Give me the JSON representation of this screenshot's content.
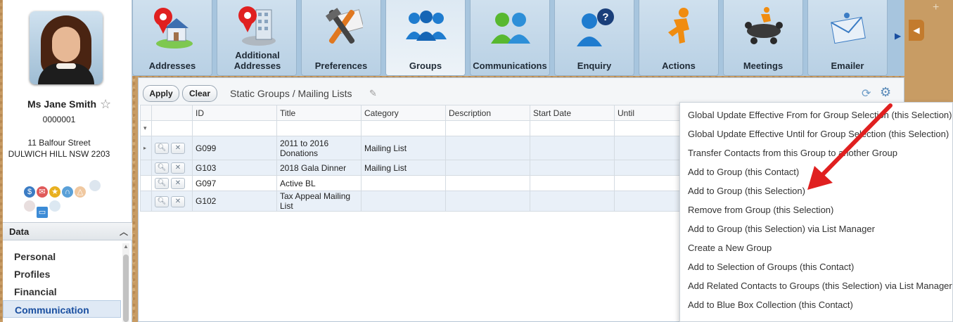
{
  "contact": {
    "name": "Ms Jane Smith",
    "id": "0000001",
    "address_line1": "11 Balfour Street",
    "address_line2": "DULWICH HILL NSW 2203"
  },
  "sidebar": {
    "section_title": "Data",
    "items": [
      {
        "label": "Personal"
      },
      {
        "label": "Profiles"
      },
      {
        "label": "Financial"
      },
      {
        "label": "Communication"
      }
    ],
    "active_item": "Communication"
  },
  "tabs": [
    {
      "label": "Addresses",
      "icon": "map-pin-house-icon"
    },
    {
      "label": "Additional Addresses",
      "icon": "map-pin-building-icon"
    },
    {
      "label": "Preferences",
      "icon": "tools-icon"
    },
    {
      "label": "Groups",
      "icon": "people-group-icon"
    },
    {
      "label": "Communications",
      "icon": "people-talking-icon"
    },
    {
      "label": "Enquiry",
      "icon": "person-question-icon"
    },
    {
      "label": "Actions",
      "icon": "running-person-icon"
    },
    {
      "label": "Meetings",
      "icon": "meeting-table-icon"
    },
    {
      "label": "Emailer",
      "icon": "envelope-icon"
    }
  ],
  "active_tab": "Groups",
  "toolbar": {
    "apply_label": "Apply",
    "clear_label": "Clear",
    "title": "Static Groups / Mailing Lists"
  },
  "grid": {
    "columns": [
      "ID",
      "Title",
      "Category",
      "Description",
      "Start Date",
      "Until"
    ],
    "rows": [
      {
        "id": "G099",
        "title": "2011 to 2016 Donations",
        "category": "Mailing List",
        "description": "",
        "start_date": "",
        "until": ""
      },
      {
        "id": "G103",
        "title": "2018 Gala Dinner",
        "category": "Mailing List",
        "description": "",
        "start_date": "",
        "until": ""
      },
      {
        "id": "G097",
        "title": "Active BL",
        "category": "",
        "description": "",
        "start_date": "",
        "until": ""
      },
      {
        "id": "G102",
        "title": "Tax Appeal Mailing List",
        "category": "",
        "description": "",
        "start_date": "",
        "until": ""
      }
    ]
  },
  "menu": {
    "items": [
      "Global Update Effective From for Group Selection (this Selection)",
      "Global Update Effective Until for Group Selection (this Selection)",
      "Transfer Contacts from this Group to another Group",
      "Add to Group (this Contact)",
      "Add to Group (this Selection)",
      "Remove from Group (this Selection)",
      "Add to Group (this Selection) via List Manager",
      "Create a New Group",
      "Add to Selection of Groups (this Contact)",
      "Add Related Contacts to Groups (this Selection) via List Manager",
      "Add to Blue Box Collection (this Contact)"
    ]
  },
  "colors": {
    "tab_bg": "#b8d0e4",
    "accent": "#1a4fa0",
    "annotation_arrow": "#e02020"
  }
}
